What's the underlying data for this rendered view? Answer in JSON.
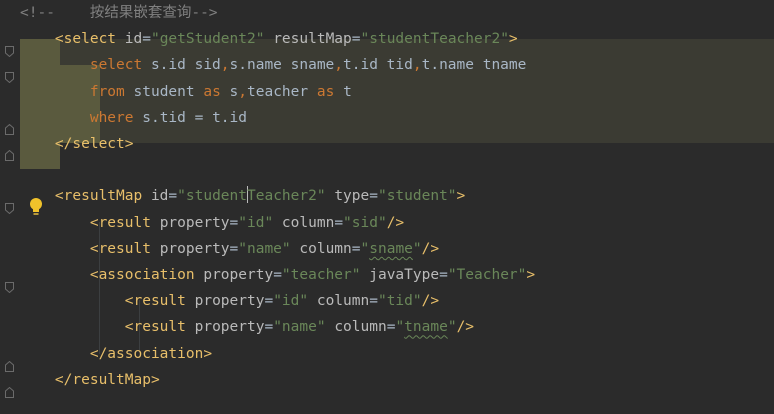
{
  "editor": {
    "lines": [
      [
        {
          "t": "<!--    ",
          "c": "cm"
        },
        {
          "t": "按结果嵌套查询",
          "c": "cm"
        },
        {
          "t": "-->",
          "c": "cm"
        }
      ],
      [
        {
          "t": "    ",
          "c": ""
        },
        {
          "t": "<select ",
          "c": "tag"
        },
        {
          "t": "id",
          "c": "attr"
        },
        {
          "t": "=",
          "c": ""
        },
        {
          "t": "\"getStudent2\"",
          "c": "val"
        },
        {
          "t": " ",
          "c": ""
        },
        {
          "t": "resultMap",
          "c": "attr"
        },
        {
          "t": "=",
          "c": ""
        },
        {
          "t": "\"studentTeacher2\"",
          "c": "val"
        },
        {
          "t": ">",
          "c": "tag"
        }
      ],
      [
        {
          "t": "        ",
          "c": ""
        },
        {
          "t": "select ",
          "c": "kw"
        },
        {
          "t": "s.id sid",
          "c": ""
        },
        {
          "t": ",",
          "c": "kw"
        },
        {
          "t": "s.name sname",
          "c": ""
        },
        {
          "t": ",",
          "c": "kw"
        },
        {
          "t": "t.id tid",
          "c": ""
        },
        {
          "t": ",",
          "c": "kw"
        },
        {
          "t": "t.name tname",
          "c": ""
        }
      ],
      [
        {
          "t": "        ",
          "c": ""
        },
        {
          "t": "from ",
          "c": "kw"
        },
        {
          "t": "student ",
          "c": ""
        },
        {
          "t": "as ",
          "c": "kw"
        },
        {
          "t": "s",
          "c": ""
        },
        {
          "t": ",",
          "c": "kw"
        },
        {
          "t": "teacher ",
          "c": ""
        },
        {
          "t": "as ",
          "c": "kw"
        },
        {
          "t": "t",
          "c": ""
        }
      ],
      [
        {
          "t": "        ",
          "c": ""
        },
        {
          "t": "where ",
          "c": "kw"
        },
        {
          "t": "s.tid = t.id",
          "c": ""
        }
      ],
      [
        {
          "t": "    ",
          "c": ""
        },
        {
          "t": "</select>",
          "c": "tag"
        }
      ],
      [],
      [
        {
          "t": "    ",
          "c": ""
        },
        {
          "t": "<resultMap ",
          "c": "tag"
        },
        {
          "t": "id",
          "c": "attr"
        },
        {
          "t": "=",
          "c": ""
        },
        {
          "t": "\"student",
          "c": "val"
        },
        {
          "t": "|caret|",
          "c": "caret"
        },
        {
          "t": "Teacher2\"",
          "c": "val"
        },
        {
          "t": " ",
          "c": ""
        },
        {
          "t": "type",
          "c": "attr"
        },
        {
          "t": "=",
          "c": ""
        },
        {
          "t": "\"student\"",
          "c": "val"
        },
        {
          "t": ">",
          "c": "tag"
        }
      ],
      [
        {
          "t": "        ",
          "c": ""
        },
        {
          "t": "<result ",
          "c": "tag"
        },
        {
          "t": "property",
          "c": "attr"
        },
        {
          "t": "=",
          "c": ""
        },
        {
          "t": "\"id\"",
          "c": "val"
        },
        {
          "t": " ",
          "c": ""
        },
        {
          "t": "column",
          "c": "attr"
        },
        {
          "t": "=",
          "c": ""
        },
        {
          "t": "\"sid\"",
          "c": "val"
        },
        {
          "t": "/>",
          "c": "tag"
        }
      ],
      [
        {
          "t": "        ",
          "c": ""
        },
        {
          "t": "<result ",
          "c": "tag"
        },
        {
          "t": "property",
          "c": "attr"
        },
        {
          "t": "=",
          "c": ""
        },
        {
          "t": "\"name\"",
          "c": "val"
        },
        {
          "t": " ",
          "c": ""
        },
        {
          "t": "column",
          "c": "attr"
        },
        {
          "t": "=",
          "c": ""
        },
        {
          "t": "\"",
          "c": "val"
        },
        {
          "t": "sname",
          "c": "val sq"
        },
        {
          "t": "\"",
          "c": "val"
        },
        {
          "t": "/>",
          "c": "tag"
        }
      ],
      [
        {
          "t": "        ",
          "c": ""
        },
        {
          "t": "<association ",
          "c": "tag"
        },
        {
          "t": "property",
          "c": "attr"
        },
        {
          "t": "=",
          "c": ""
        },
        {
          "t": "\"teacher\"",
          "c": "val"
        },
        {
          "t": " ",
          "c": ""
        },
        {
          "t": "javaType",
          "c": "attr"
        },
        {
          "t": "=",
          "c": ""
        },
        {
          "t": "\"Teacher\"",
          "c": "val"
        },
        {
          "t": ">",
          "c": "tag"
        }
      ],
      [
        {
          "t": "            ",
          "c": ""
        },
        {
          "t": "<result ",
          "c": "tag"
        },
        {
          "t": "property",
          "c": "attr"
        },
        {
          "t": "=",
          "c": ""
        },
        {
          "t": "\"id\"",
          "c": "val"
        },
        {
          "t": " ",
          "c": ""
        },
        {
          "t": "column",
          "c": "attr"
        },
        {
          "t": "=",
          "c": ""
        },
        {
          "t": "\"tid\"",
          "c": "val"
        },
        {
          "t": "/>",
          "c": "tag"
        }
      ],
      [
        {
          "t": "            ",
          "c": ""
        },
        {
          "t": "<result ",
          "c": "tag"
        },
        {
          "t": "property",
          "c": "attr"
        },
        {
          "t": "=",
          "c": ""
        },
        {
          "t": "\"name\"",
          "c": "val"
        },
        {
          "t": " ",
          "c": ""
        },
        {
          "t": "column",
          "c": "attr"
        },
        {
          "t": "=",
          "c": ""
        },
        {
          "t": "\"",
          "c": "val"
        },
        {
          "t": "tname",
          "c": "val sq"
        },
        {
          "t": "\"",
          "c": "val"
        },
        {
          "t": "/>",
          "c": "tag"
        }
      ],
      [
        {
          "t": "        ",
          "c": ""
        },
        {
          "t": "</association>",
          "c": "tag"
        }
      ],
      [
        {
          "t": "    ",
          "c": ""
        },
        {
          "t": "</resultMap>",
          "c": "tag"
        }
      ]
    ]
  },
  "colors": {
    "background": "#2b2b2b",
    "tag": "#e8bf6a",
    "attribute": "#bababa",
    "string": "#6a8759",
    "keyword": "#cc7832",
    "comment": "#808080",
    "text": "#a9b7c6",
    "highlight": "#3a3b32"
  },
  "icons": {
    "fold": "fold-marker-icon",
    "intention": "lightbulb-icon"
  }
}
